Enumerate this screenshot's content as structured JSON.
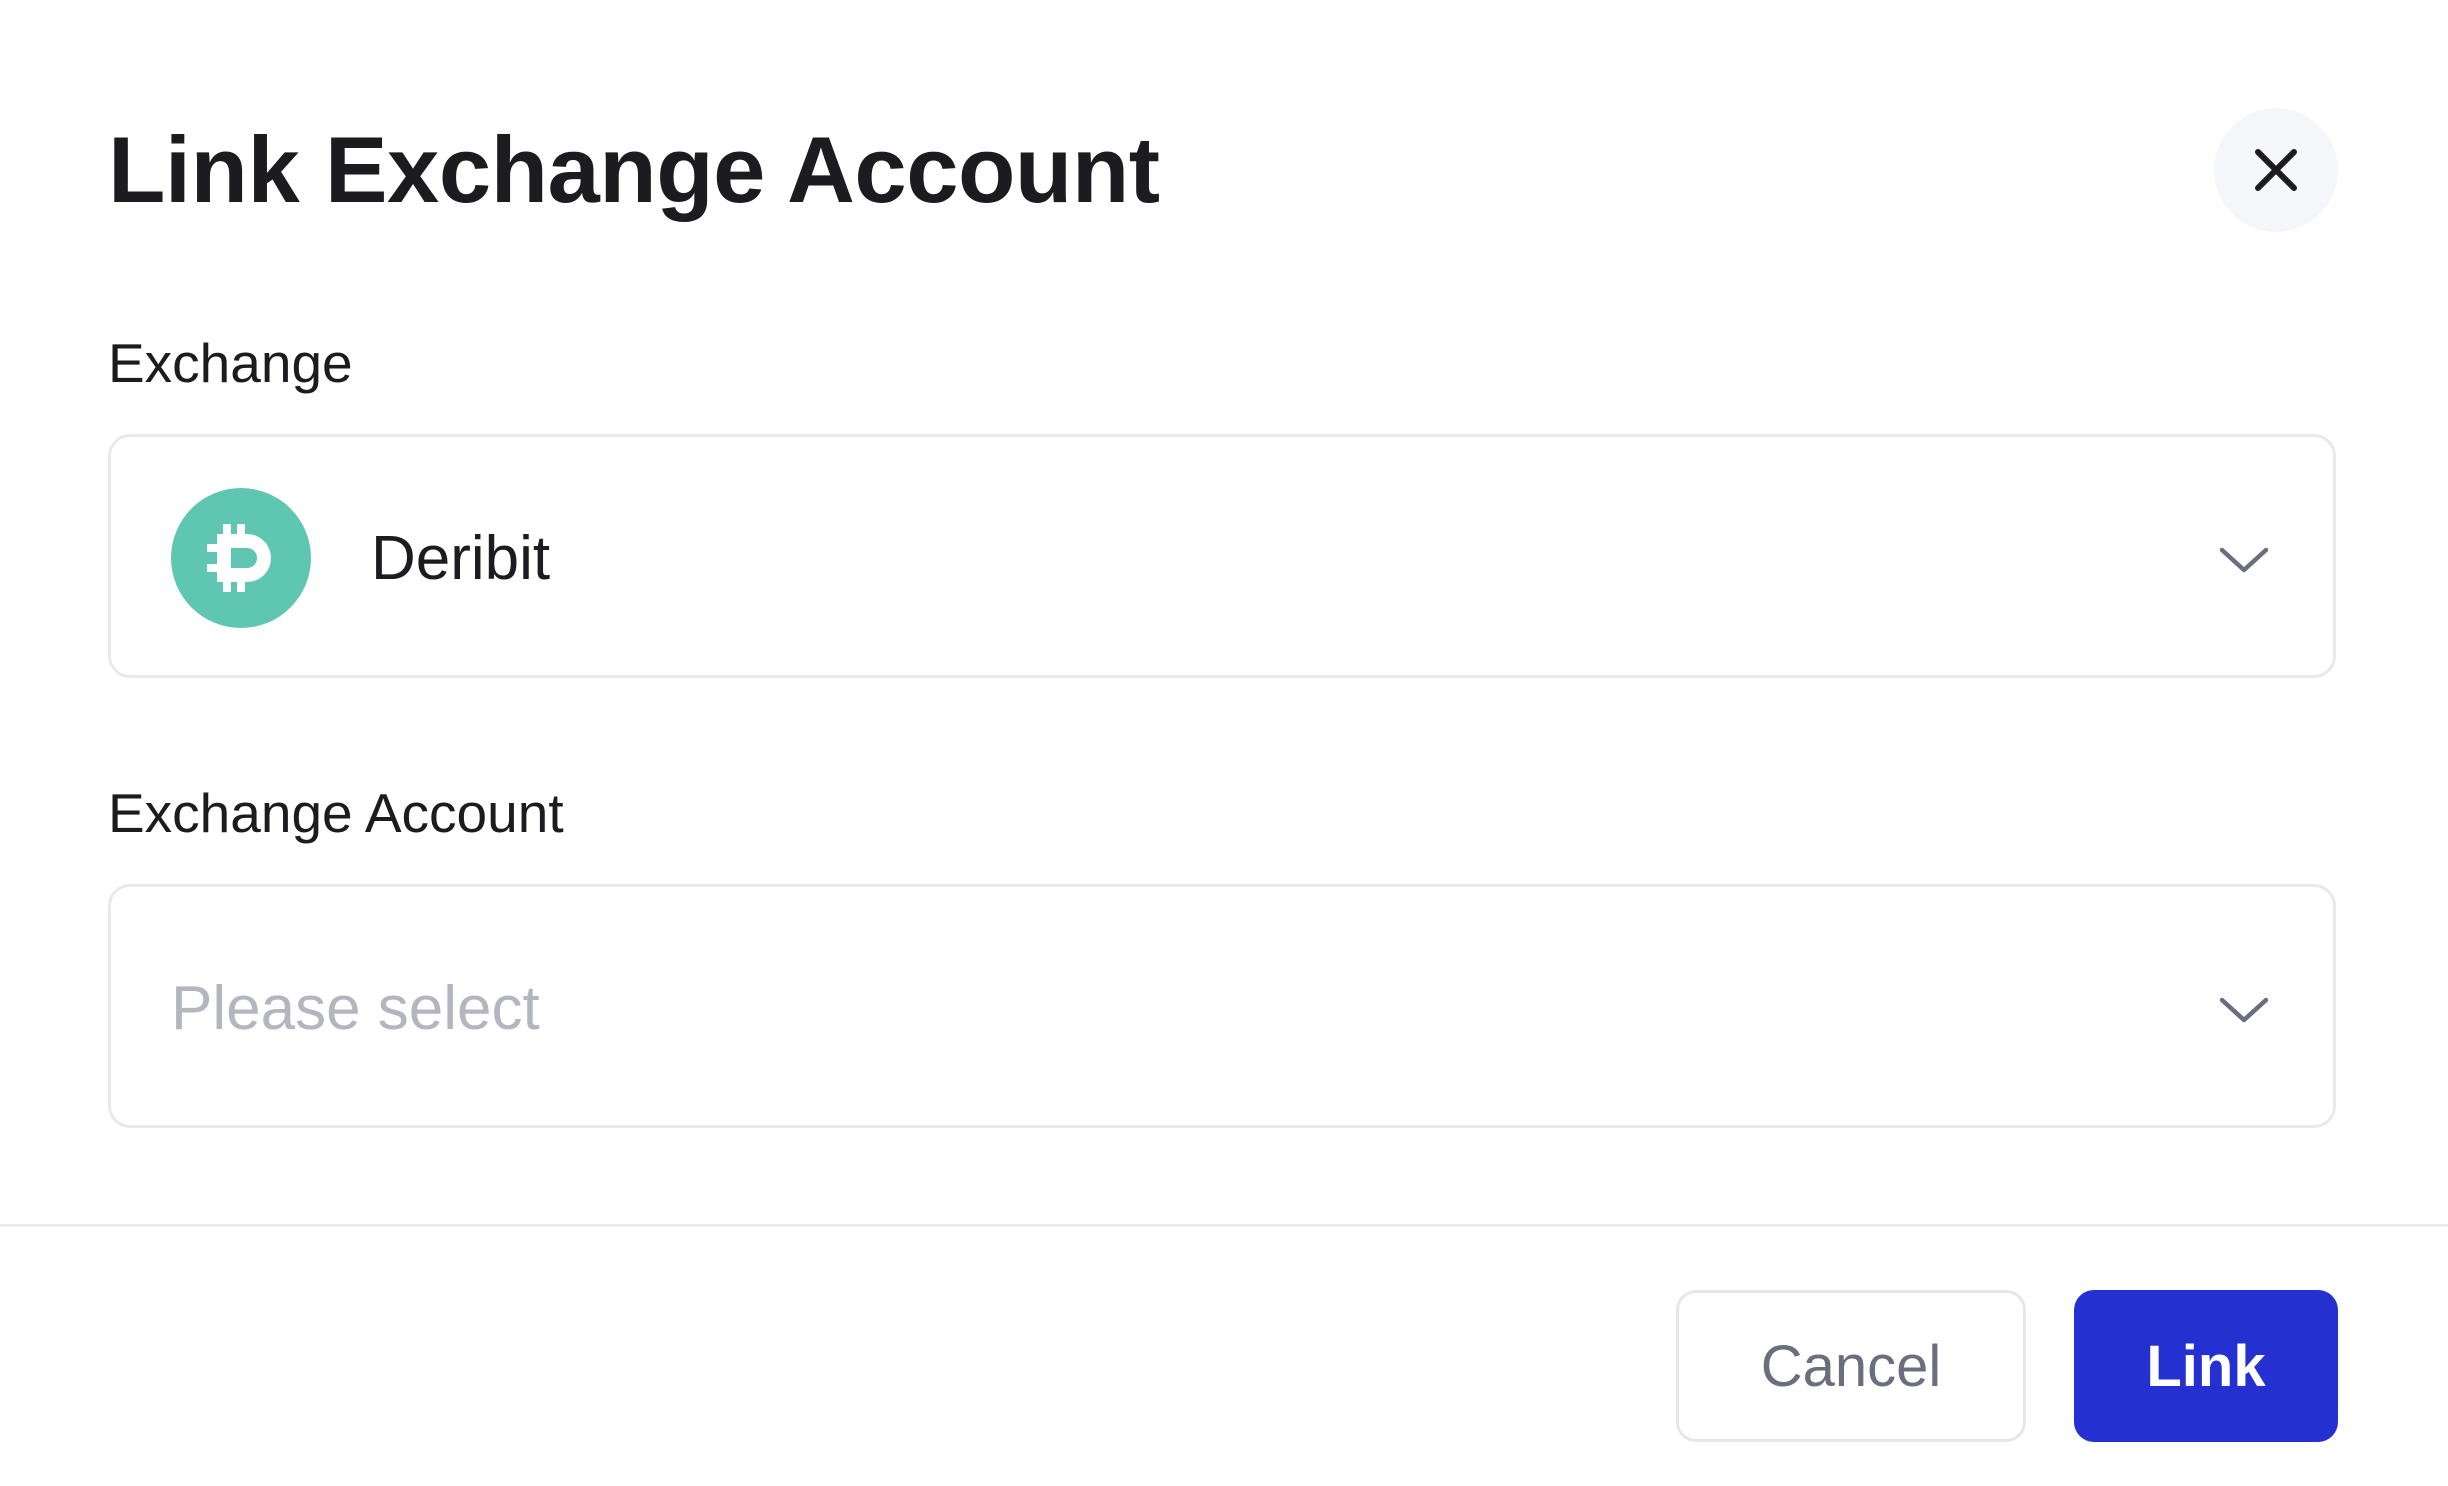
{
  "dialog": {
    "title": "Link Exchange Account",
    "close_icon": "close-icon"
  },
  "exchange_field": {
    "label": "Exchange",
    "selected_value": "Deribit",
    "logo_icon": "deribit-logo-icon",
    "logo_color": "#5ec6b1",
    "dropdown_icon": "chevron-down-icon"
  },
  "account_field": {
    "label": "Exchange Account",
    "placeholder": "Please select",
    "dropdown_icon": "chevron-down-icon"
  },
  "footer": {
    "cancel_label": "Cancel",
    "link_label": "Link",
    "primary_color": "#2430d0"
  }
}
